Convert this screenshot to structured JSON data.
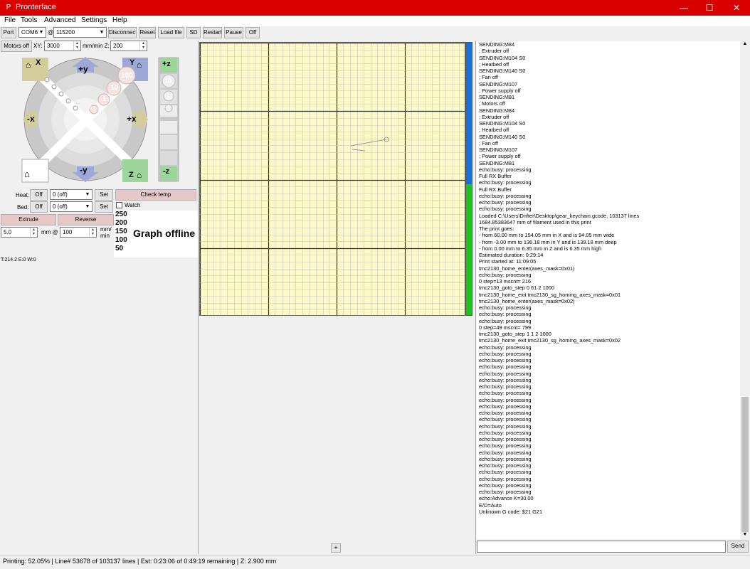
{
  "window": {
    "title": "Pronterface",
    "app_icon": "P",
    "minimize": "—",
    "maximize": "☐",
    "close": "✕"
  },
  "menu": [
    "File",
    "Tools",
    "Advanced",
    "Settings",
    "Help"
  ],
  "toolbar": {
    "port_label": "Port",
    "port_value": "COM6",
    "at": "@",
    "baud_value": "115200",
    "disconnect": "Disconnect",
    "reset": "Reset",
    "load_file": "Load file",
    "sd": "SD",
    "restart": "Restart",
    "pause": "Pause",
    "off": "Off"
  },
  "motion": {
    "motors_off": "Motors off",
    "xy_label": "XY:",
    "xy_value": "3000",
    "mm_min_z": "mm/min Z:",
    "z_value": "200",
    "home_x": "X",
    "home_y": "Y",
    "home_z": "Z",
    "plus_y": "+y",
    "minus_y": "-y",
    "plus_x": "+x",
    "minus_x": "-x",
    "plus_z": "+z",
    "minus_z": "-z",
    "step_100": "100",
    "step_10": "10",
    "step_1": "1",
    "step_01": "0.1",
    "zstep_10": "10",
    "zstep_1": "1",
    "zstep_01": "0.1"
  },
  "temps": {
    "heat_label": "Heat:",
    "heat_off": "Off",
    "heat_value": "0 (off)",
    "heat_set": "Set",
    "bed_label": "Bed:",
    "bed_off": "Off",
    "bed_value": "0 (off)",
    "bed_set": "Set",
    "check_temp": "Check temp",
    "watch": "Watch"
  },
  "extrude": {
    "extrude": "Extrude",
    "reverse": "Reverse",
    "length": "5.0",
    "mm_at": "mm @",
    "speed": "100",
    "unit_top": "mm/",
    "unit_bottom": "min"
  },
  "graph": {
    "ticks": [
      "250",
      "200",
      "150",
      "100",
      "50"
    ],
    "offline": "Graph offline"
  },
  "temp_readout": "T:214.2 E:0 W:0",
  "plater": {
    "expand_button": "+",
    "progress_fraction": 0.52
  },
  "colors": {
    "titlebar": "#d90000",
    "plater_bg": "#fbf9c5",
    "progress_blue": "#1c6fd8",
    "progress_green": "#1ec41e",
    "button_pink": "#e6c8c8"
  },
  "log": [
    "SENDING:M84",
    "; Extruder off",
    "SENDING:M104 S0",
    "; Heatbed off",
    "SENDING:M140 S0",
    "; Fan off",
    "SENDING:M107",
    "; Power supply off",
    "SENDING:M81",
    "; Motors off",
    "SENDING:M84",
    "; Extruder off",
    "SENDING:M104 S0",
    "; Heatbed off",
    "SENDING:M140 S0",
    "; Fan off",
    "SENDING:M107",
    "; Power supply off",
    "SENDING:M81",
    "echo:busy: processing",
    "Full RX Buffer",
    "echo:busy: processing",
    "Full RX Buffer",
    "echo:busy: processing",
    "echo:busy: processing",
    "echo:busy: processing",
    "Loaded C:\\Users\\Drifter\\Desktop\\gear_keychain.gcode, 103137 lines",
    "1684.85383647 mm of filament used in this print",
    "The print goes:",
    "- from 60.00 mm to 154.05 mm in X and is 94.05 mm wide",
    "- from -3.00 mm to 136.18 mm in Y and is 139.18 mm deep",
    "- from 0.00 mm to 6.35 mm in Z and is 6.35 mm high",
    "Estimated duration: 0:29:14",
    "Print started at: 11:09:05",
    "tmc2130_home_enter(axes_mask=0x01)",
    "echo:busy: processing",
    "  0 step=13 mscnt= 216",
    "tmc2130_goto_step 0 61 2 1000",
    "tmc2130_home_exit tmc2130_sg_homing_axes_mask=0x01",
    "tmc2130_home_enter(axes_mask=0x02)",
    "echo:busy: processing",
    "echo:busy: processing",
    "echo:busy: processing",
    "  0 step=49 mscnt= 799",
    "tmc2130_goto_step 1 1 2 1000",
    "tmc2130_home_exit tmc2130_sg_homing_axes_mask=0x02",
    "echo:busy: processing",
    "echo:busy: processing",
    "echo:busy: processing",
    "echo:busy: processing",
    "echo:busy: processing",
    "echo:busy: processing",
    "echo:busy: processing",
    "echo:busy: processing",
    "echo:busy: processing",
    "echo:busy: processing",
    "echo:busy: processing",
    "echo:busy: processing",
    "echo:busy: processing",
    "echo:busy: processing",
    "echo:busy: processing",
    "echo:busy: processing",
    "echo:busy: processing",
    "echo:busy: processing",
    "echo:busy: processing",
    "echo:busy: processing",
    "echo:busy: processing",
    "echo:busy: processing",
    "echo:busy: processing",
    "echo:Advance K=30.00",
    " E/D=Auto",
    "Unknown G code: $21 G21"
  ],
  "command": {
    "value": "",
    "send": "Send"
  },
  "status": "Printing: 52.05% | Line# 53678 of 103137 lines | Est: 0:23:06 of 0:49:19 remaining |  Z: 2.900 mm"
}
